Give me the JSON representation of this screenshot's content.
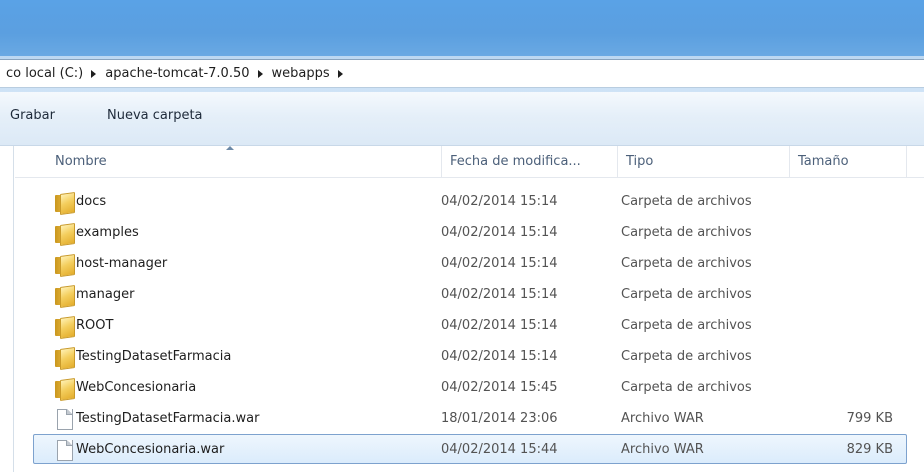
{
  "address": {
    "crumbs": [
      "co local (C:)",
      "apache-tomcat-7.0.50",
      "webapps"
    ]
  },
  "toolbar": {
    "burn_label": "Grabar",
    "new_folder_label": "Nueva carpeta"
  },
  "columns": {
    "name": "Nombre",
    "date": "Fecha de modifica...",
    "type": "Tipo",
    "size": "Tamaño"
  },
  "files": [
    {
      "icon": "folder-icon",
      "name": "docs",
      "date": "04/02/2014 15:14",
      "type": "Carpeta de archivos",
      "size": ""
    },
    {
      "icon": "folder-icon",
      "name": "examples",
      "date": "04/02/2014 15:14",
      "type": "Carpeta de archivos",
      "size": ""
    },
    {
      "icon": "folder-icon",
      "name": "host-manager",
      "date": "04/02/2014 15:14",
      "type": "Carpeta de archivos",
      "size": ""
    },
    {
      "icon": "folder-icon",
      "name": "manager",
      "date": "04/02/2014 15:14",
      "type": "Carpeta de archivos",
      "size": ""
    },
    {
      "icon": "folder-icon",
      "name": "ROOT",
      "date": "04/02/2014 15:14",
      "type": "Carpeta de archivos",
      "size": ""
    },
    {
      "icon": "folder-icon",
      "name": "TestingDatasetFarmacia",
      "date": "04/02/2014 15:14",
      "type": "Carpeta de archivos",
      "size": ""
    },
    {
      "icon": "folder-icon",
      "name": "WebConcesionaria",
      "date": "04/02/2014 15:45",
      "type": "Carpeta de archivos",
      "size": ""
    },
    {
      "icon": "file-icon",
      "name": "TestingDatasetFarmacia.war",
      "date": "18/01/2014 23:06",
      "type": "Archivo WAR",
      "size": "799 KB"
    },
    {
      "icon": "file-icon",
      "name": "WebConcesionaria.war",
      "date": "04/02/2014 15:44",
      "type": "Archivo WAR",
      "size": "829 KB",
      "selected": true
    }
  ],
  "colors": {
    "titlebar": "#5b9fe0",
    "selection_border": "#7da2ce",
    "selection_fill": "#dbecfc",
    "header_text": "#4c607a"
  }
}
